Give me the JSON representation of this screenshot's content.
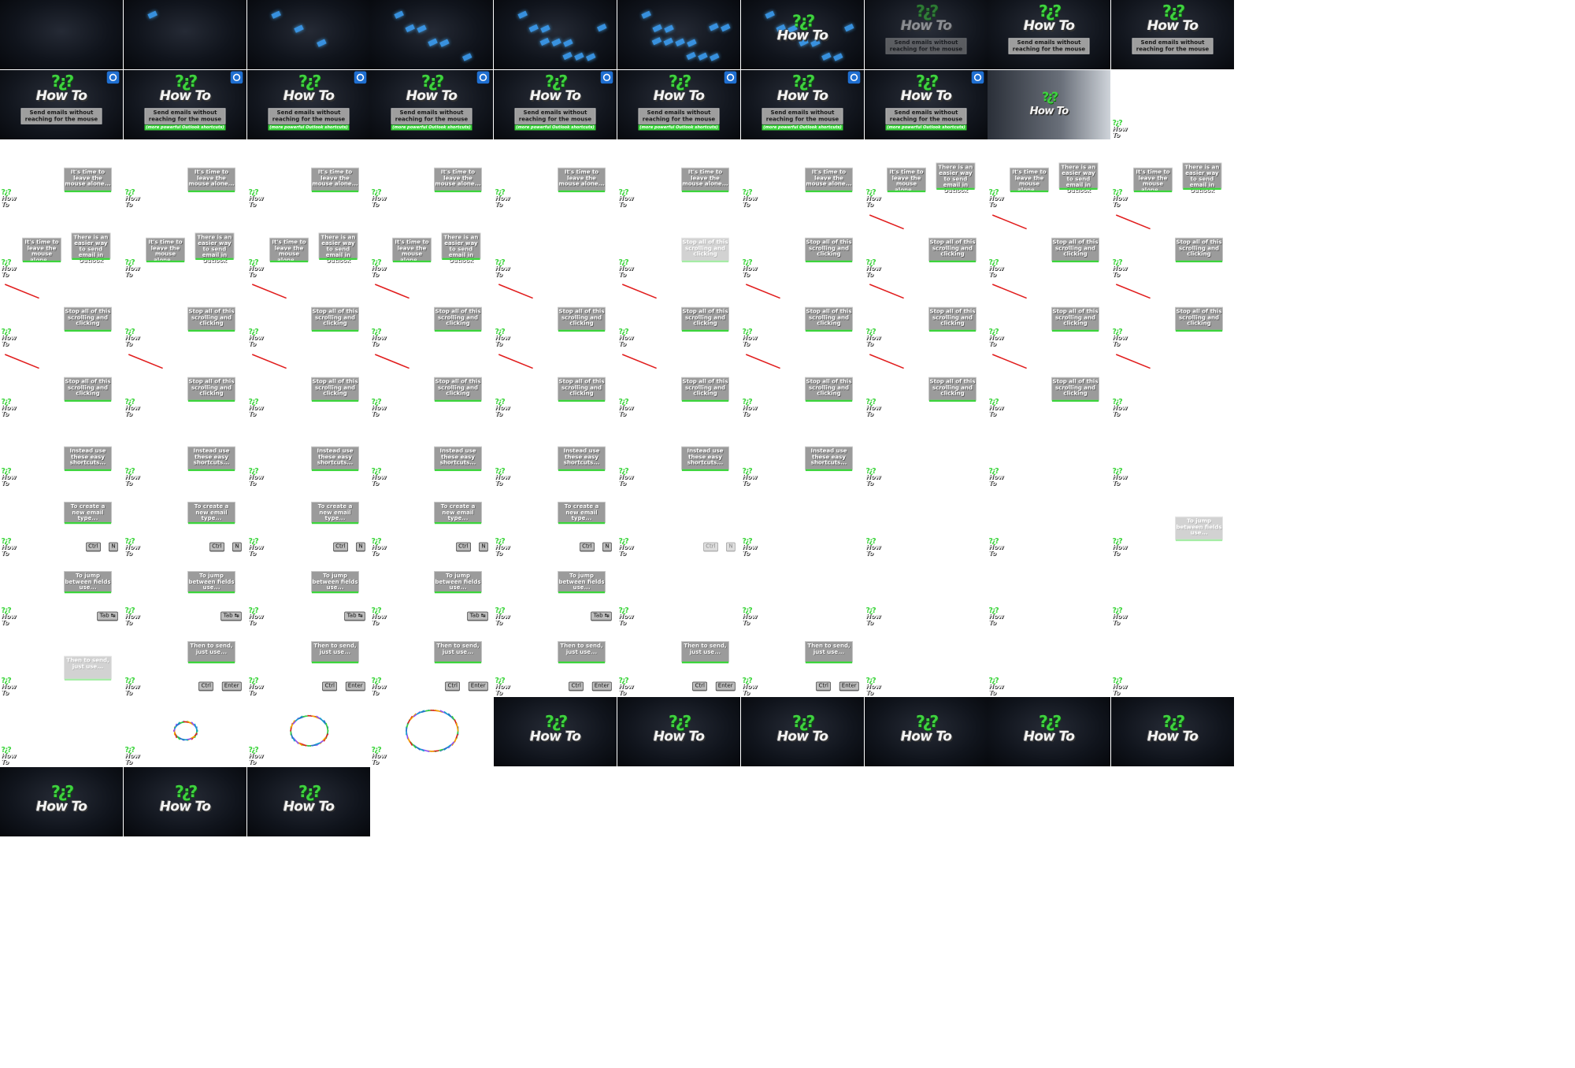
{
  "sheet": {
    "columns": 10,
    "rows": 12,
    "frame_count": 113
  },
  "brand": {
    "logo_marks": "?¿?",
    "logo_text": "How To",
    "accent_green": "#3bd43b",
    "outlook_blue": "#1f6fd1",
    "arrow_red": "#e11d1d"
  },
  "intro": {
    "subtitle": "Send emails without reaching for the mouse",
    "strip": "(more powerful Outlook shortcuts)"
  },
  "captions": {
    "leave_mouse": "It's time to leave the mouse alone...",
    "easier_way": "There is an easier way to send email in Outlook",
    "stop_scrolling": "Stop all of this scrolling and clicking",
    "easy_shortcuts": "Instead use these easy shortcuts...",
    "new_email": "To create a new email type...",
    "jump_fields": "To jump between fields use...",
    "then_send": "Then to send, just use..."
  },
  "keys": {
    "ctrl": "Ctrl",
    "n": "N",
    "tab": "Tab ↹",
    "enter": "Enter",
    "plus": "+"
  },
  "frames": [
    {
      "kind": "dark",
      "streaks": 0
    },
    {
      "kind": "dark",
      "streaks": 1
    },
    {
      "kind": "dark",
      "streaks": 3
    },
    {
      "kind": "dark",
      "streaks": 6
    },
    {
      "kind": "dark",
      "streaks": 10
    },
    {
      "kind": "dark",
      "streaks": 12
    },
    {
      "kind": "dark",
      "streaks": 8,
      "logo": true
    },
    {
      "kind": "intro",
      "fade": 0.5
    },
    {
      "kind": "intro"
    },
    {
      "kind": "intro"
    },
    {
      "kind": "intro",
      "outlook": true
    },
    {
      "kind": "intro",
      "outlook": true,
      "strip": true
    },
    {
      "kind": "intro",
      "outlook": true,
      "strip": true
    },
    {
      "kind": "intro",
      "outlook": true,
      "strip": true
    },
    {
      "kind": "intro",
      "outlook": true,
      "strip": true
    },
    {
      "kind": "intro",
      "outlook": true,
      "strip": true
    },
    {
      "kind": "intro",
      "outlook": true,
      "strip": true
    },
    {
      "kind": "intro",
      "outlook": true,
      "strip": true
    },
    {
      "kind": "transition"
    },
    {
      "kind": "ui"
    },
    {
      "kind": "ui",
      "caption": "leave_mouse"
    },
    {
      "kind": "ui",
      "caption": "leave_mouse"
    },
    {
      "kind": "ui",
      "caption": "leave_mouse"
    },
    {
      "kind": "ui",
      "caption": "leave_mouse"
    },
    {
      "kind": "ui",
      "caption": "leave_mouse"
    },
    {
      "kind": "ui",
      "caption": "leave_mouse"
    },
    {
      "kind": "ui",
      "caption": "leave_mouse"
    },
    {
      "kind": "ui",
      "caption": "leave_mouse",
      "caption2": "easier_way"
    },
    {
      "kind": "ui",
      "caption": "leave_mouse",
      "caption2": "easier_way"
    },
    {
      "kind": "ui",
      "caption": "leave_mouse",
      "caption2": "easier_way"
    },
    {
      "kind": "ui",
      "caption": "leave_mouse",
      "caption2": "easier_way"
    },
    {
      "kind": "ui",
      "caption": "leave_mouse",
      "caption2": "easier_way"
    },
    {
      "kind": "ui",
      "caption": "leave_mouse",
      "caption2": "easier_way"
    },
    {
      "kind": "ui",
      "caption": "leave_mouse",
      "caption2": "easier_way"
    },
    {
      "kind": "ui"
    },
    {
      "kind": "ui",
      "caption": "stop_scrolling",
      "faded": true
    },
    {
      "kind": "ui",
      "caption": "stop_scrolling"
    },
    {
      "kind": "ui",
      "caption": "stop_scrolling",
      "arrow": true
    },
    {
      "kind": "ui",
      "caption": "stop_scrolling",
      "arrow": true
    },
    {
      "kind": "ui",
      "caption": "stop_scrolling",
      "arrow": true
    },
    {
      "kind": "ui",
      "caption": "stop_scrolling",
      "arrow": true
    },
    {
      "kind": "ui",
      "compose": true,
      "caption": "stop_scrolling"
    },
    {
      "kind": "ui",
      "compose": true,
      "caption": "stop_scrolling",
      "arrow": true
    },
    {
      "kind": "ui",
      "compose": true,
      "caption": "stop_scrolling",
      "arrow": true
    },
    {
      "kind": "ui",
      "compose": true,
      "caption": "stop_scrolling",
      "arrow": true
    },
    {
      "kind": "ui",
      "compose": true,
      "caption": "stop_scrolling",
      "arrow": true
    },
    {
      "kind": "ui",
      "compose": true,
      "caption": "stop_scrolling",
      "arrow": true
    },
    {
      "kind": "ui",
      "compose": true,
      "caption": "stop_scrolling",
      "arrow": true
    },
    {
      "kind": "ui",
      "compose": true,
      "caption": "stop_scrolling",
      "arrow": true
    },
    {
      "kind": "ui",
      "compose": true,
      "caption": "stop_scrolling",
      "arrow": true
    },
    {
      "kind": "ui",
      "compose": true,
      "caption": "stop_scrolling",
      "arrow": true
    },
    {
      "kind": "ui",
      "compose": true,
      "caption": "stop_scrolling",
      "arrow": true
    },
    {
      "kind": "ui",
      "compose": true,
      "caption": "stop_scrolling",
      "arrow": true
    },
    {
      "kind": "ui",
      "compose": true,
      "caption": "stop_scrolling",
      "arrow": true
    },
    {
      "kind": "ui",
      "compose": true,
      "caption": "stop_scrolling",
      "arrow": true
    },
    {
      "kind": "ui",
      "compose": true,
      "caption": "stop_scrolling",
      "arrow": true
    },
    {
      "kind": "ui",
      "compose": true,
      "caption": "stop_scrolling",
      "arrow": true
    },
    {
      "kind": "ui",
      "compose": true,
      "caption": "stop_scrolling",
      "arrow": true
    },
    {
      "kind": "ui",
      "compose": true,
      "caption": "stop_scrolling",
      "arrow": true
    },
    {
      "kind": "ui",
      "compose": true,
      "arrow": true
    },
    {
      "kind": "ui",
      "compose": true,
      "caption": "easy_shortcuts"
    },
    {
      "kind": "ui",
      "compose": true,
      "caption": "easy_shortcuts"
    },
    {
      "kind": "ui",
      "compose": true,
      "caption": "easy_shortcuts"
    },
    {
      "kind": "ui",
      "compose": true,
      "caption": "easy_shortcuts"
    },
    {
      "kind": "ui",
      "compose": true,
      "caption": "easy_shortcuts"
    },
    {
      "kind": "ui",
      "compose": true,
      "caption": "easy_shortcuts"
    },
    {
      "kind": "ui",
      "compose": true,
      "caption": "easy_shortcuts"
    },
    {
      "kind": "ui",
      "compose": true
    },
    {
      "kind": "ui",
      "compose": true
    },
    {
      "kind": "ui"
    },
    {
      "kind": "ui",
      "caption": "new_email",
      "keyset": "ctrl_n"
    },
    {
      "kind": "ui",
      "caption": "new_email",
      "keyset": "ctrl_n"
    },
    {
      "kind": "ui",
      "caption": "new_email",
      "keyset": "ctrl_n"
    },
    {
      "kind": "ui",
      "caption": "new_email",
      "keyset": "ctrl_n"
    },
    {
      "kind": "ui",
      "caption": "new_email",
      "keyset": "ctrl_n"
    },
    {
      "kind": "ui",
      "keyset": "ctrl_n",
      "faded": true
    },
    {
      "kind": "ui"
    },
    {
      "kind": "ui",
      "compose": true
    },
    {
      "kind": "ui",
      "compose": true
    },
    {
      "kind": "ui",
      "compose": true,
      "caption": "jump_fields",
      "faded": true
    },
    {
      "kind": "ui",
      "compose": true,
      "caption": "jump_fields",
      "keyset": "tab"
    },
    {
      "kind": "ui",
      "compose": true,
      "caption": "jump_fields",
      "keyset": "tab"
    },
    {
      "kind": "ui",
      "compose": true,
      "caption": "jump_fields",
      "keyset": "tab"
    },
    {
      "kind": "ui",
      "compose": true,
      "caption": "jump_fields",
      "keyset": "tab"
    },
    {
      "kind": "ui",
      "compose": true,
      "caption": "jump_fields",
      "keyset": "tab"
    },
    {
      "kind": "ui",
      "compose": true
    },
    {
      "kind": "ui",
      "compose": true
    },
    {
      "kind": "ui",
      "compose": true
    },
    {
      "kind": "ui",
      "compose": true
    },
    {
      "kind": "ui",
      "compose": true
    },
    {
      "kind": "ui",
      "compose": true,
      "caption": "then_send",
      "faded": true
    },
    {
      "kind": "ui",
      "compose": true,
      "caption": "then_send",
      "keyset": "ctrl_enter"
    },
    {
      "kind": "ui",
      "compose": true,
      "caption": "then_send",
      "keyset": "ctrl_enter"
    },
    {
      "kind": "ui",
      "compose": true,
      "caption": "then_send",
      "keyset": "ctrl_enter"
    },
    {
      "kind": "ui",
      "compose": true,
      "caption": "then_send",
      "keyset": "ctrl_enter"
    },
    {
      "kind": "ui",
      "compose": true,
      "caption": "then_send",
      "keyset": "ctrl_enter"
    },
    {
      "kind": "ui",
      "compose": true,
      "caption": "then_send",
      "keyset": "ctrl_enter"
    },
    {
      "kind": "ui",
      "compose": true
    },
    {
      "kind": "ui"
    },
    {
      "kind": "ui"
    },
    {
      "kind": "ui"
    },
    {
      "kind": "burst",
      "burst": 1
    },
    {
      "kind": "burst",
      "burst": 2
    },
    {
      "kind": "burst",
      "burst": 3
    },
    {
      "kind": "outro"
    },
    {
      "kind": "outro"
    },
    {
      "kind": "outro"
    },
    {
      "kind": "outro"
    },
    {
      "kind": "outro"
    },
    {
      "kind": "outro"
    },
    {
      "kind": "outro"
    },
    {
      "kind": "outro"
    },
    {
      "kind": "outro"
    }
  ]
}
